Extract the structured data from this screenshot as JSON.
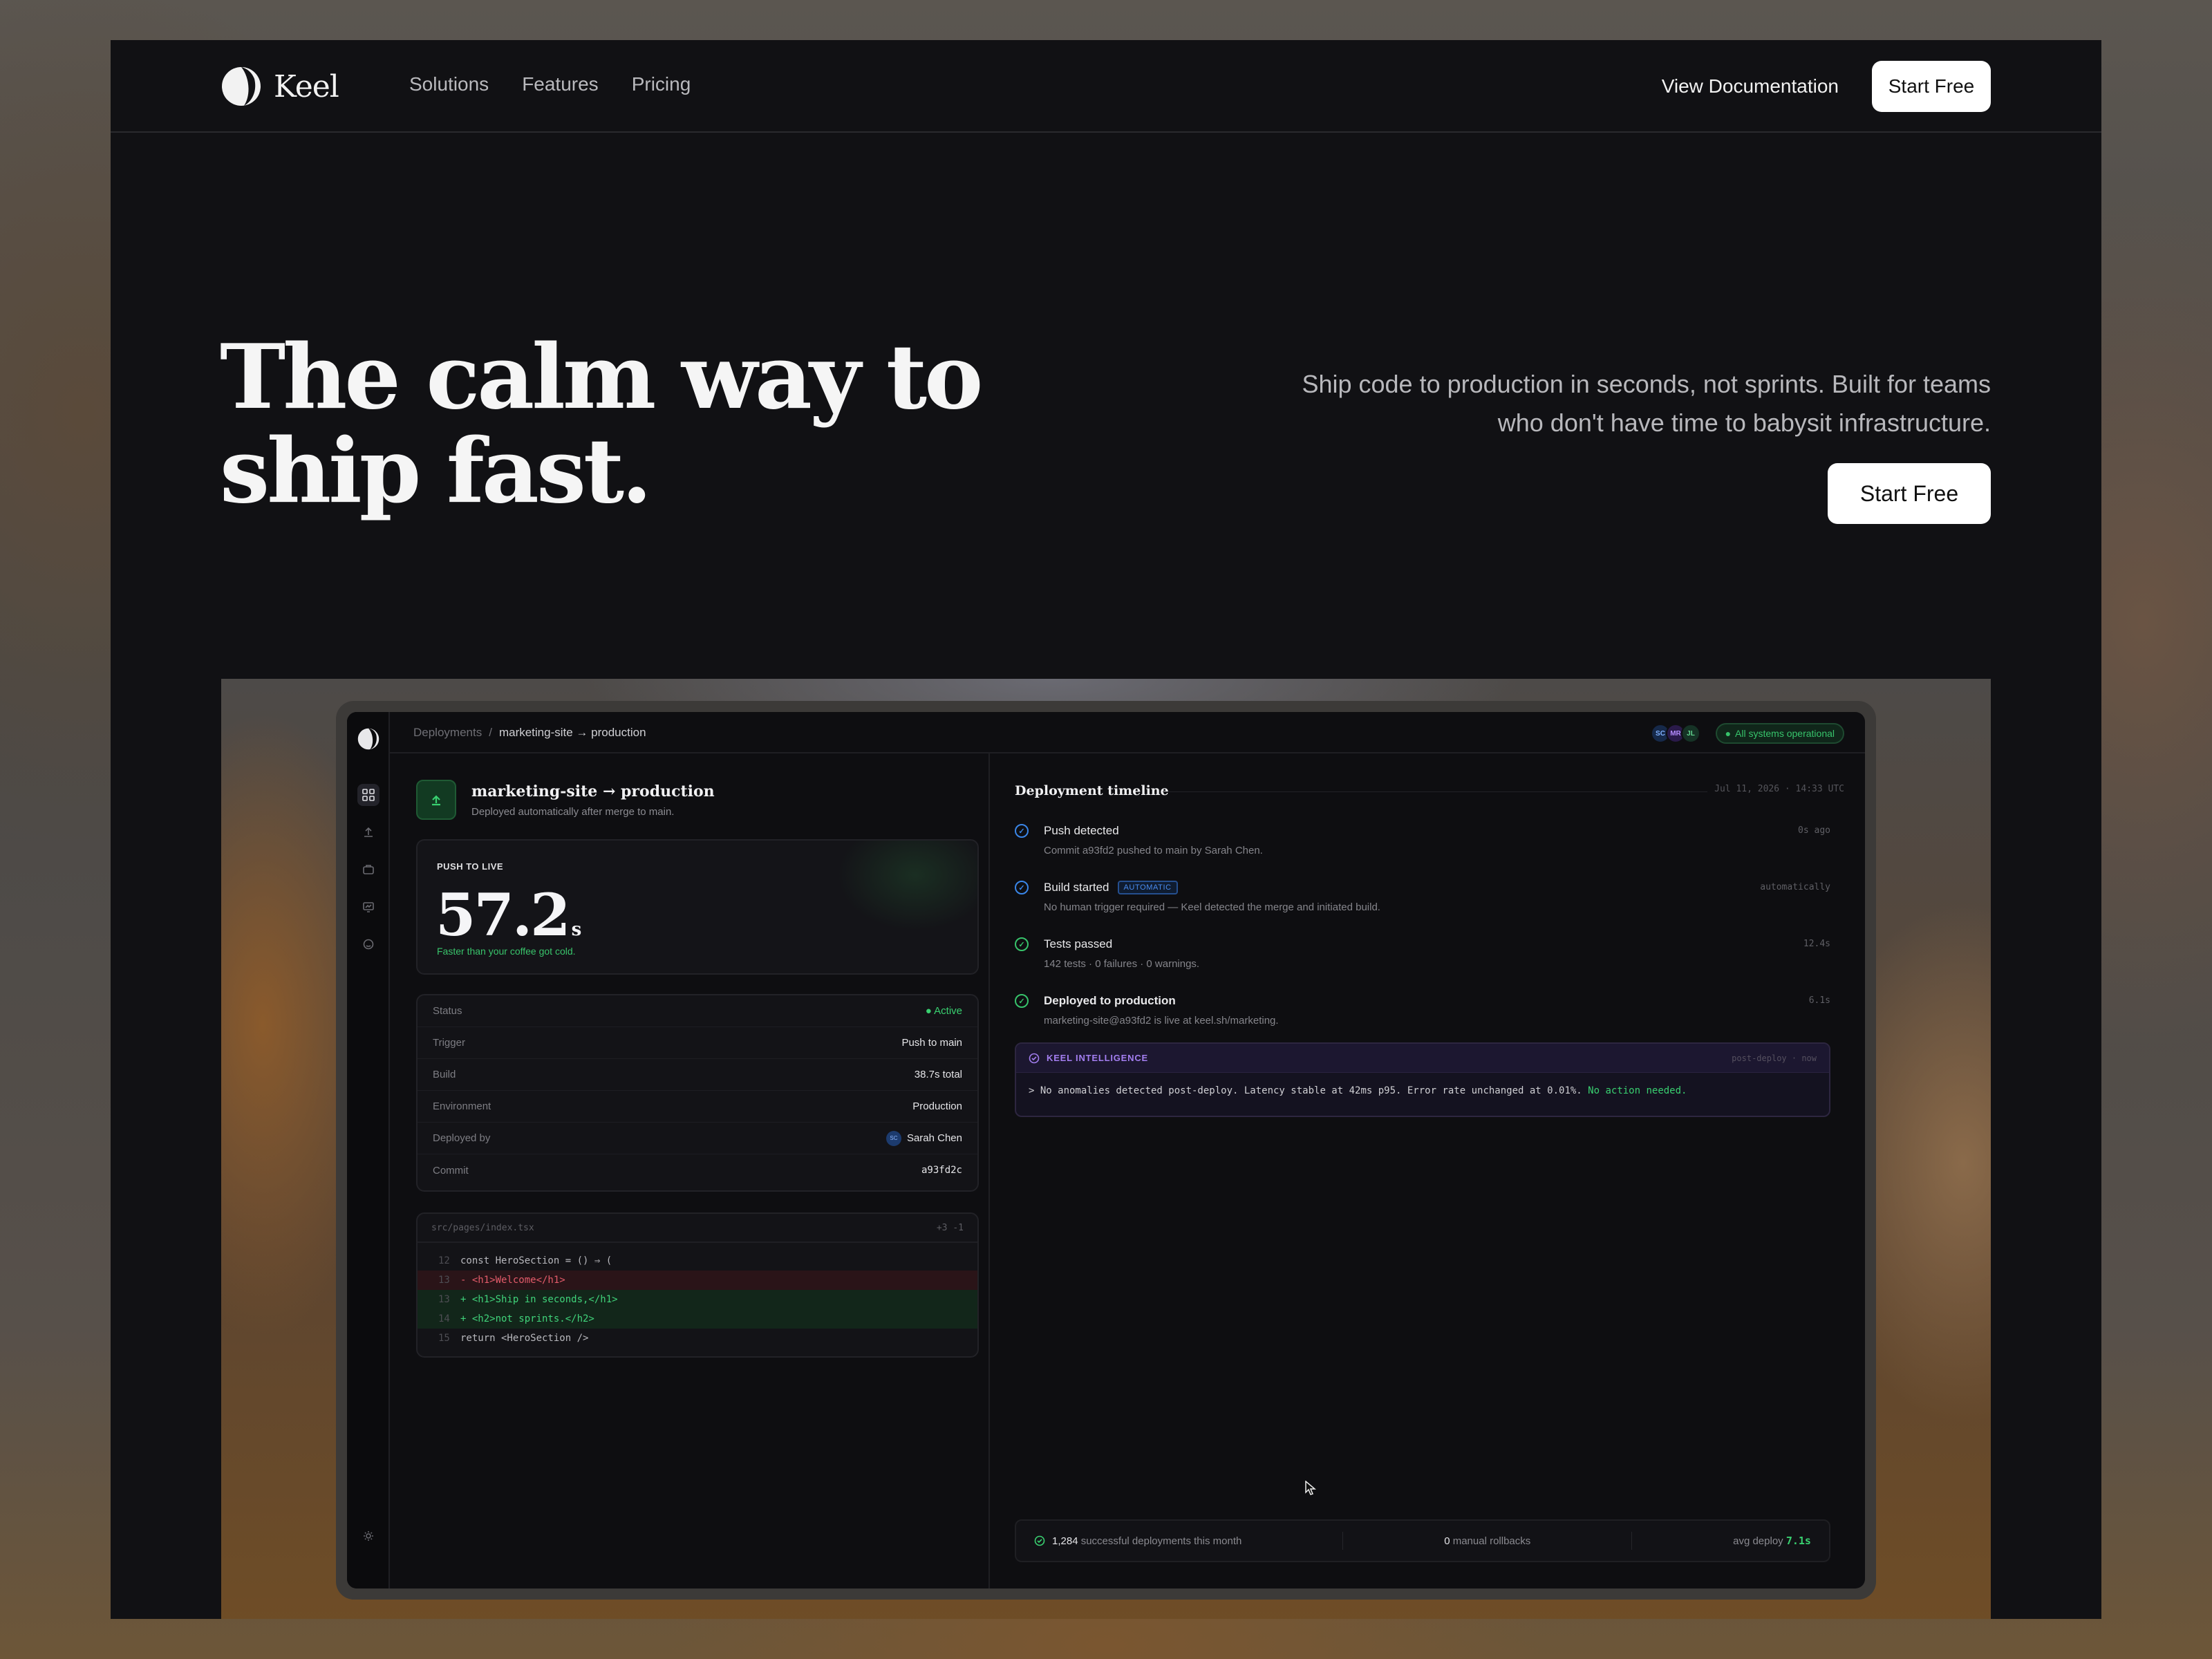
{
  "nav": {
    "brand": "Keel",
    "links": [
      "Solutions",
      "Features",
      "Pricing"
    ],
    "doc_link": "View Documentation",
    "cta": "Start Free"
  },
  "hero": {
    "title_line1": "The calm way to",
    "title_line2": "ship fast.",
    "subtitle": "Ship code to production in seconds, not sprints. Built for teams who don't have time to babysit infrastructure.",
    "cta": "Start Free"
  },
  "app": {
    "breadcrumb": {
      "root": "Deployments",
      "sep": "/",
      "current": "marketing-site → production"
    },
    "avatars": [
      "SC",
      "MR",
      "JL"
    ],
    "status": "All systems operational",
    "deployment": {
      "title": "marketing-site → production",
      "subtitle": "Deployed automatically after merge to main."
    },
    "push_to_live": {
      "label": "PUSH TO LIVE",
      "value": "57.2",
      "unit": "s",
      "note": "Faster than your coffee got cold."
    },
    "properties": [
      {
        "key": "Status",
        "value": "● Active"
      },
      {
        "key": "Trigger",
        "value": "Push to main"
      },
      {
        "key": "Build",
        "value": "38.7s total"
      },
      {
        "key": "Environment",
        "value": "Production"
      },
      {
        "key": "Deployed by",
        "value": "Sarah Chen",
        "avatar": "SC"
      },
      {
        "key": "Commit",
        "value": "a93fd2c"
      }
    ],
    "code": {
      "file": "src/pages/index.tsx",
      "diffstat": "+3 -1",
      "lines": [
        {
          "n": "12",
          "text": "const HeroSection = () ⇒ (",
          "kind": "ctx"
        },
        {
          "n": "13",
          "text": "- <h1>Welcome</h1>",
          "kind": "del"
        },
        {
          "n": "13",
          "text": "+ <h1>Ship in seconds,</h1>",
          "kind": "add"
        },
        {
          "n": "14",
          "text": "+ <h2>not sprints.</h2>",
          "kind": "add"
        },
        {
          "n": "15",
          "text": "return <HeroSection />",
          "kind": "ctx"
        }
      ]
    },
    "timeline": {
      "title": "Deployment timeline",
      "date": "Jul 11, 2026 · 14:33 UTC",
      "items": [
        {
          "name": "Push detected",
          "desc": "Commit a93fd2 pushed to main by Sarah Chen.",
          "time": "0s ago"
        },
        {
          "name": "Build started",
          "badge": "AUTOMATIC",
          "desc": "No human trigger required — Keel detected the merge and initiated build.",
          "time": "automatically"
        },
        {
          "name": "Tests passed",
          "desc": "142 tests · 0 failures · 0 warnings.",
          "time": "12.4s"
        },
        {
          "name": "Deployed to production",
          "desc": "marketing-site@a93fd2 is live at keel.sh/marketing.",
          "time": "6.1s"
        }
      ]
    },
    "intelligence": {
      "label": "KEEL INTELLIGENCE",
      "time": "post-deploy · now",
      "prefix": "> ",
      "message": "No anomalies detected post-deploy. Latency stable at 42ms p95. Error rate unchanged at 0.01%.",
      "verdict": "No action needed."
    },
    "stats": {
      "deploys_count": "1,284",
      "deploys_label": "successful deployments this month",
      "rollbacks_count": "0",
      "rollbacks_label": "manual rollbacks",
      "avg_label": "avg deploy",
      "avg_value": "7.1s"
    }
  },
  "colors": {
    "accent_green": "#39d070",
    "accent_blue": "#3a86e8",
    "accent_purple": "#a37ef0",
    "page_bg": "#111114"
  }
}
